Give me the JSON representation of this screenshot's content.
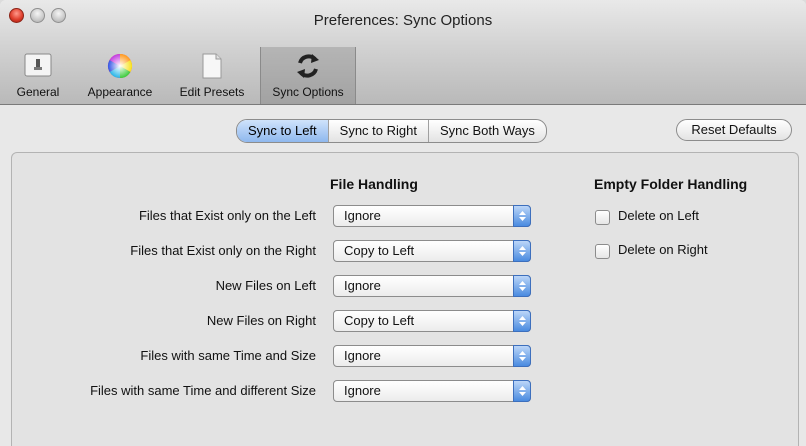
{
  "window": {
    "title": "Preferences: Sync Options"
  },
  "toolbar": {
    "items": [
      {
        "label": "General",
        "icon": "general-switch-icon"
      },
      {
        "label": "Appearance",
        "icon": "color-wheel-icon"
      },
      {
        "label": "Edit Presets",
        "icon": "document-icon"
      },
      {
        "label": "Sync Options",
        "icon": "sync-arrows-icon",
        "selected": true
      }
    ]
  },
  "sync_direction": {
    "options": [
      "Sync to Left",
      "Sync to Right",
      "Sync Both Ways"
    ],
    "selected": "Sync to Left"
  },
  "reset_label": "Reset Defaults",
  "file_handling": {
    "header": "File Handling",
    "rows": [
      {
        "label": "Files that Exist only on the Left",
        "value": "Ignore"
      },
      {
        "label": "Files that Exist only on the Right",
        "value": "Copy to Left"
      },
      {
        "label": "New Files on Left",
        "value": "Ignore"
      },
      {
        "label": "New Files on Right",
        "value": "Copy to Left"
      },
      {
        "label": "Files with same Time and Size",
        "value": "Ignore"
      },
      {
        "label": "Files with same Time and different Size",
        "value": "Ignore"
      }
    ]
  },
  "empty_folder": {
    "header": "Empty Folder Handling",
    "options": [
      {
        "label": "Delete on Left",
        "checked": false
      },
      {
        "label": "Delete on Right",
        "checked": false
      }
    ]
  },
  "colors": {
    "accent": "#8fb8ee",
    "popup_arrow": "#4a8be0",
    "close": "#e0402e"
  }
}
